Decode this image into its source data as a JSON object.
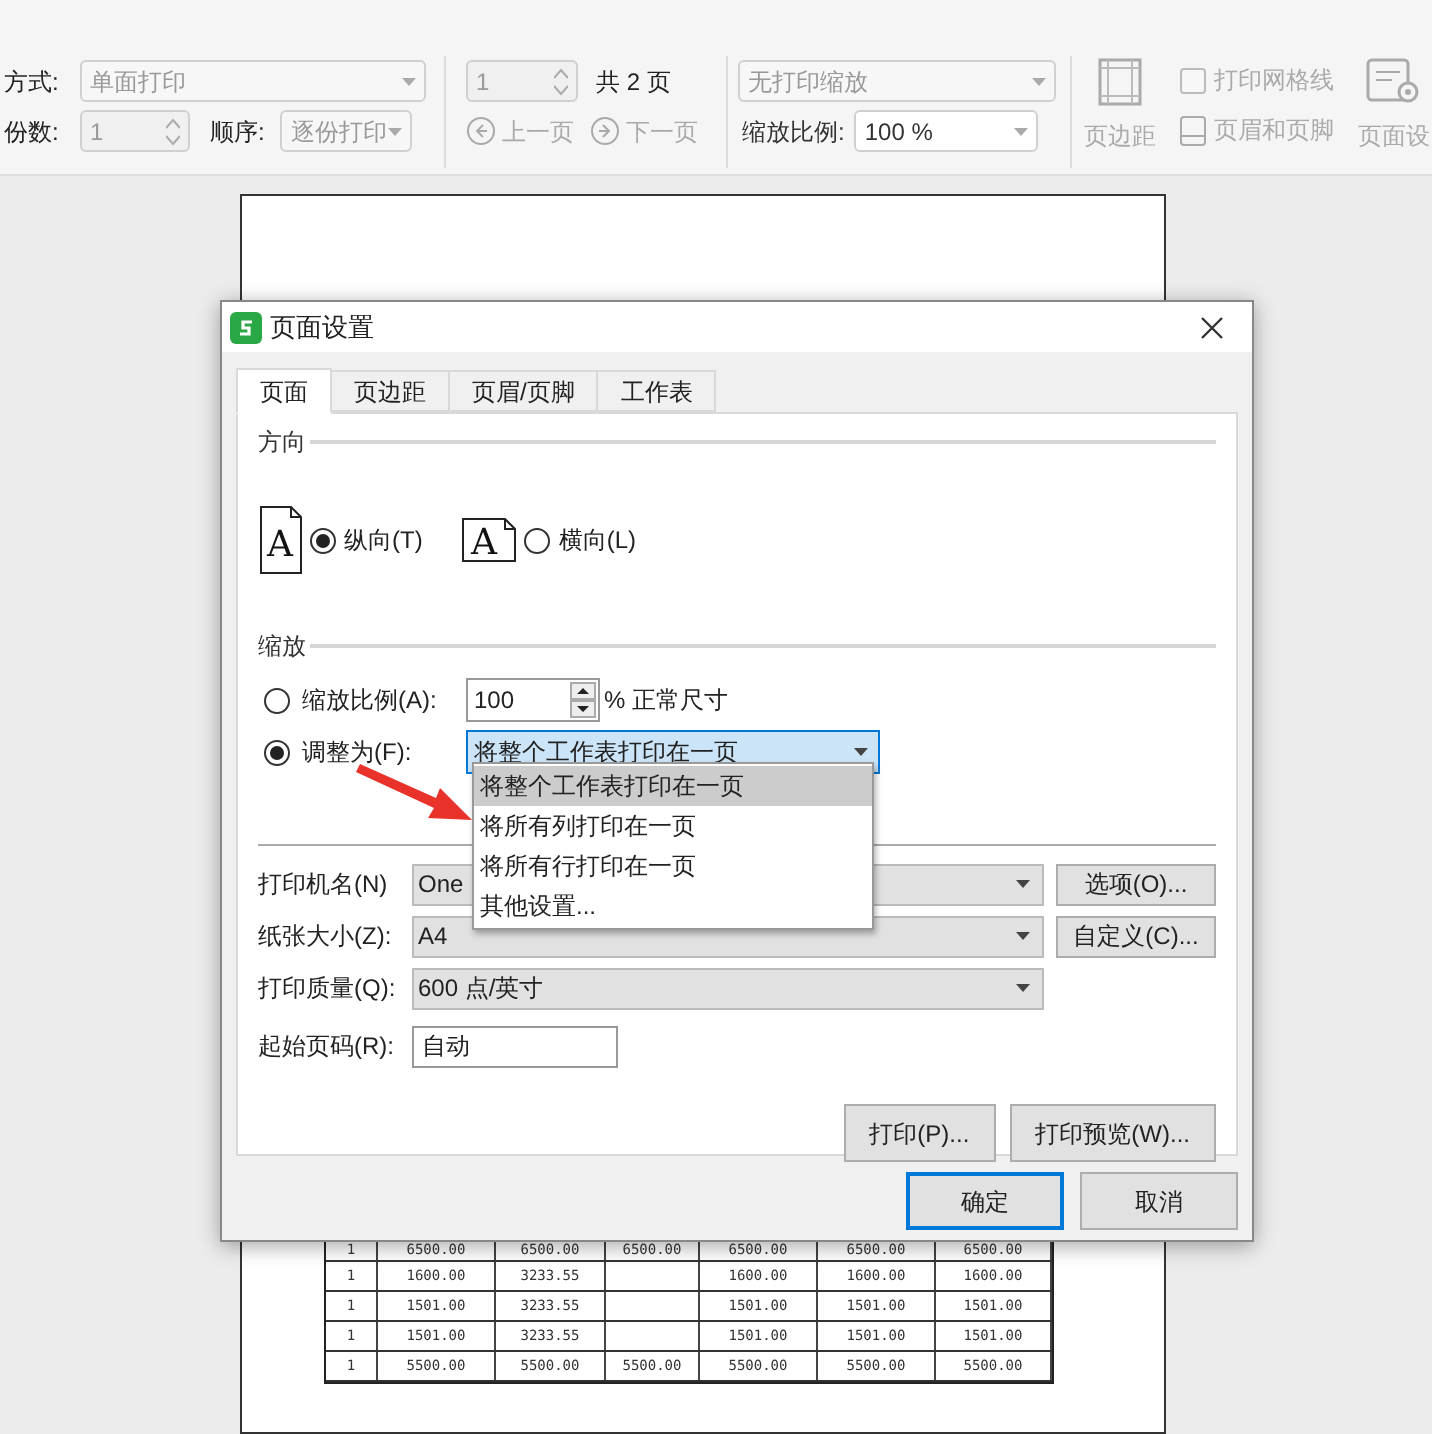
{
  "toolbar": {
    "mode_label": "方式:",
    "mode_value": "单面打印",
    "copies_label": "份数:",
    "copies_value": "1",
    "order_label": "顺序:",
    "order_value": "逐份打印",
    "page_value": "1",
    "page_total": "共 2 页",
    "prev_page": "上一页",
    "next_page": "下一页",
    "scale_mode": "无打印缩放",
    "scale_label": "缩放比例:",
    "scale_value": "100 %",
    "margins": "页边距",
    "gridlines": {
      "label": "打印网格线",
      "checked": false
    },
    "header_footer": "页眉和页脚",
    "page_setup": "页面设"
  },
  "dialog": {
    "title": "页面设置",
    "tabs": [
      {
        "label": "页面",
        "selected": true
      },
      {
        "label": "页边距",
        "selected": false
      },
      {
        "label": "页眉/页脚",
        "selected": false
      },
      {
        "label": "工作表",
        "selected": false
      }
    ],
    "orientation": {
      "label": "方向",
      "options": [
        {
          "kind": "portrait",
          "icon_letter": "A",
          "label": "纵向(T)",
          "selected": true
        },
        {
          "kind": "landscape",
          "icon_letter": "A",
          "label": "横向(L)",
          "selected": false
        }
      ]
    },
    "scaling": {
      "label": "缩放",
      "scale": {
        "label": "缩放比例(A):",
        "selected": false,
        "value": "100",
        "suffix": "% 正常尺寸"
      },
      "fit": {
        "label": "调整为(F):",
        "selected": true,
        "value": "将整个工作表打印在一页"
      },
      "dropdown": [
        {
          "label": "将整个工作表打印在一页",
          "selected": true
        },
        {
          "label": "将所有列打印在一页",
          "selected": false
        },
        {
          "label": "将所有行打印在一页",
          "selected": false
        },
        {
          "label": "其他设置...",
          "selected": false
        }
      ]
    },
    "printer_rows": [
      {
        "label": "打印机名(N)",
        "value": "One",
        "button": "选项(O)..."
      },
      {
        "label": "纸张大小(Z):",
        "value": "A4",
        "button": "自定义(C)..."
      },
      {
        "label": "打印质量(Q):",
        "value": "600 点/英寸"
      }
    ],
    "start_page": {
      "label": "起始页码(R):",
      "value": "自动"
    },
    "action_buttons": [
      "打印(P)...",
      "打印预览(W)..."
    ],
    "footer_buttons": [
      {
        "label": "确定",
        "selected": true
      },
      {
        "label": "取消",
        "selected": false
      }
    ]
  },
  "sheet_rows": [
    [
      "1",
      "6500.00",
      "6500.00",
      "6500.00",
      "6500.00",
      "6500.00",
      "6500.00"
    ],
    [
      "1",
      "1600.00",
      "3233.55",
      null,
      "1600.00",
      "1600.00",
      "1600.00"
    ],
    [
      "1",
      "1501.00",
      "3233.55",
      null,
      "1501.00",
      "1501.00",
      "1501.00"
    ],
    [
      "1",
      "1501.00",
      "3233.55",
      null,
      "1501.00",
      "1501.00",
      "1501.00"
    ],
    [
      "1",
      "5500.00",
      "5500.00",
      "5500.00",
      "5500.00",
      "5500.00",
      "5500.00"
    ]
  ]
}
